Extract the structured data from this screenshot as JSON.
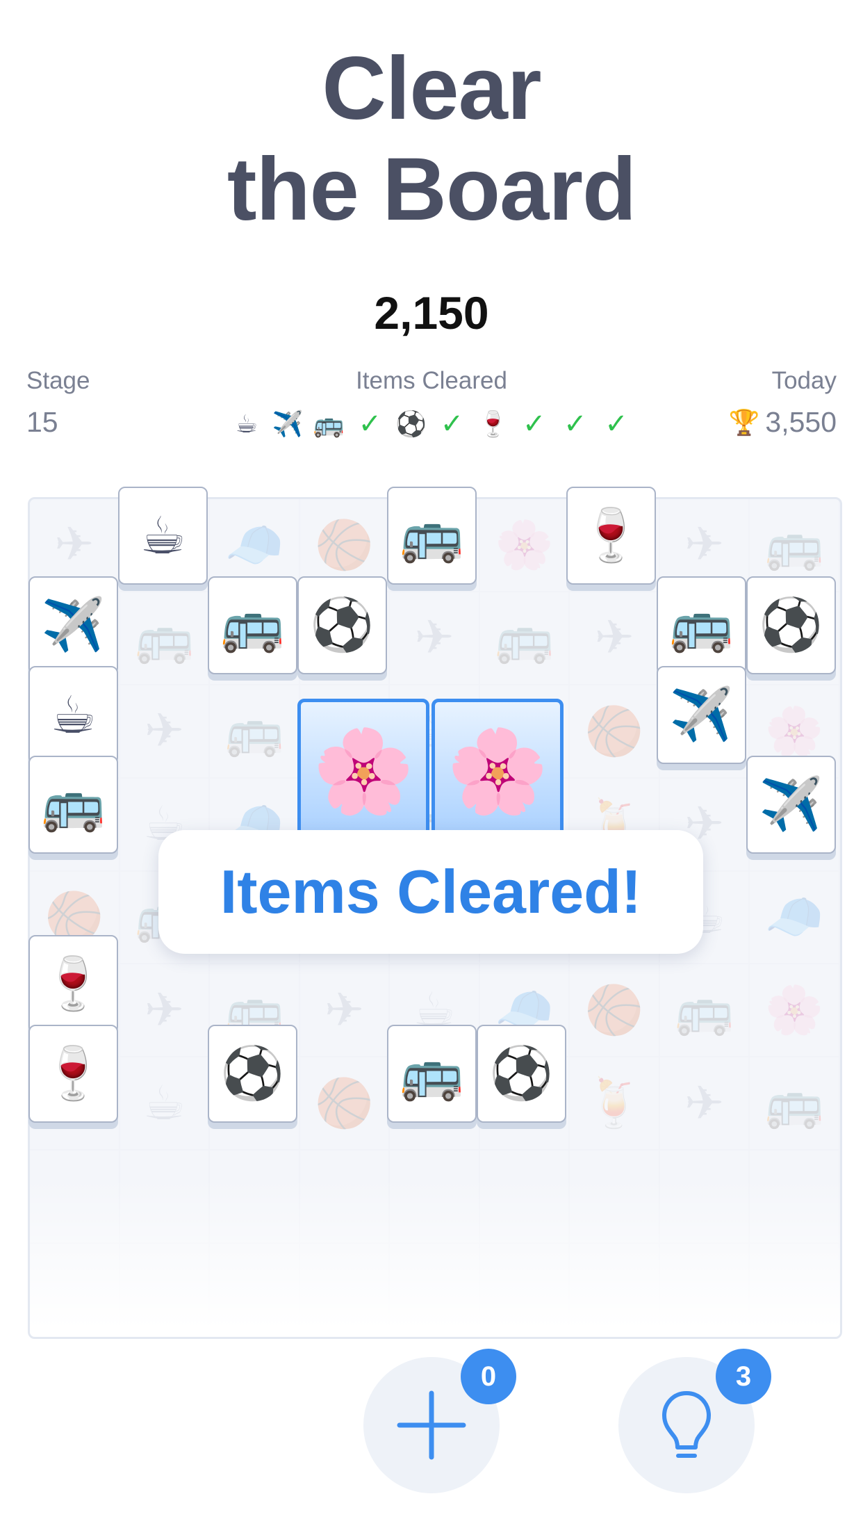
{
  "title_line1": "Clear",
  "title_line2": "the Board",
  "score": "2,150",
  "stage": {
    "label": "Stage",
    "value": "15"
  },
  "items_cleared": {
    "label": "Items Cleared",
    "items": [
      "☕",
      "✈️",
      "🚌",
      "✓",
      "⚽",
      "✓",
      "🍷",
      "✓",
      "✓",
      "✓"
    ]
  },
  "today": {
    "label": "Today",
    "value": "3,550",
    "icon": "trophy-icon"
  },
  "board": {
    "background_symbols": [
      "✈",
      "☕",
      "🧢",
      "🏀",
      "🚌",
      "🌸",
      "🍹",
      "✈",
      "🚌"
    ],
    "tiles": [
      "☕",
      "🚌",
      "🍷",
      "✈️",
      "🚌",
      "⚽",
      "🚌",
      "⚽",
      "☕",
      "✈️",
      "🚌",
      "✈️",
      "🍷",
      "🍷",
      "⚽",
      "🚌",
      "⚽"
    ],
    "selected_tiles": [
      "🌸",
      "🌸"
    ]
  },
  "banner": "Items Cleared!",
  "add_button": {
    "icon": "plus-icon",
    "count": "0"
  },
  "hint_button": {
    "icon": "lightbulb-icon",
    "count": "3"
  },
  "colors": {
    "accent": "#3d8ef0",
    "title": "#4b5064",
    "check": "#2fc14d"
  }
}
